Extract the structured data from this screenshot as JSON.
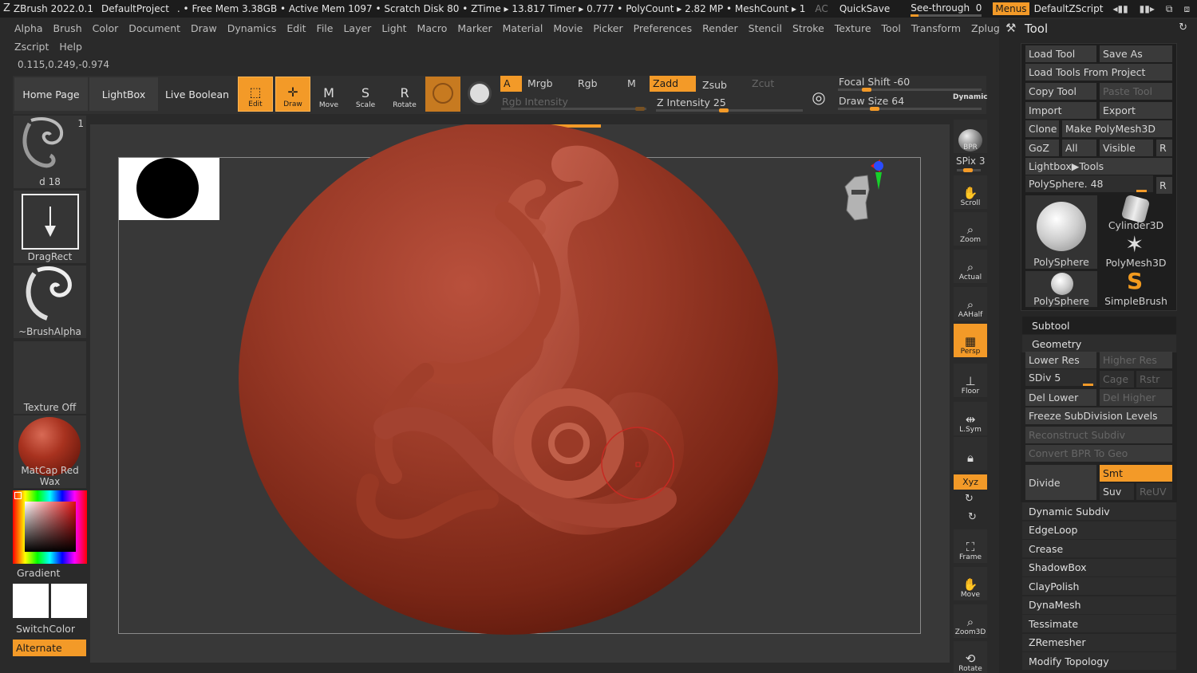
{
  "titlebar": {
    "app": "ZBrush 2022.0.1",
    "project": "DefaultProject",
    "stats": ". • Free Mem 3.38GB • Active Mem 1097 • Scratch Disk 80 • ZTime ▸ 13.817 Timer ▸ 0.777 • PolyCount ▸ 2.82 MP • MeshCount ▸ 1",
    "ac": "AC",
    "quicksave": "QuickSave",
    "seethrough": "See-through",
    "seethrough_value": "0",
    "menus": "Menus",
    "default_zscript": "DefaultZScript"
  },
  "menus": {
    "row1": [
      "Alpha",
      "Brush",
      "Color",
      "Document",
      "Draw",
      "Dynamics",
      "Edit",
      "File",
      "Layer",
      "Light",
      "Macro",
      "Marker",
      "Material",
      "Movie",
      "Picker",
      "Preferences",
      "Render",
      "Stencil",
      "Stroke",
      "Texture",
      "Tool",
      "Transform",
      "Zplugin"
    ],
    "row2": [
      "Zscript",
      "Help"
    ]
  },
  "coords": "0.115,0.249,-0.974",
  "shelf": {
    "home_page": "Home Page",
    "lightbox": "LightBox",
    "live_boolean": "Live Boolean",
    "edit": "Edit",
    "draw": "Draw",
    "move": "Move",
    "scale": "Scale",
    "rotate": "Rotate",
    "a": "A",
    "mrgb": "Mrgb",
    "rgb": "Rgb",
    "m": "M",
    "rgb_intensity": "Rgb Intensity",
    "zadd": "Zadd",
    "zsub": "Zsub",
    "zcut": "Zcut",
    "z_intensity": "Z Intensity 25",
    "z_intensity_value": 25,
    "focal_shift": "Focal Shift -60",
    "draw_size": "Draw Size 64",
    "dynamic": "Dynamic"
  },
  "left": {
    "brush_count": "1",
    "stroke_label": "d 18",
    "dragrect": "DragRect",
    "brushalpha": "~BrushAlpha",
    "texture_off": "Texture Off",
    "matcap": "MatCap Red Wax",
    "gradient": "Gradient",
    "switchcolor": "SwitchColor",
    "alternate": "Alternate"
  },
  "right_shelf": {
    "bpr": "BPR",
    "spix": "SPix 3",
    "scroll": "Scroll",
    "zoom": "Zoom",
    "actual": "Actual",
    "aahalf": "AAHalf",
    "persp": "Persp",
    "floor": "Floor",
    "lsym": "L.Sym",
    "xyz": "Xyz",
    "frame": "Frame",
    "move": "Move",
    "zoom3d": "Zoom3D",
    "rotate": "Rotate"
  },
  "tool": {
    "title": "Tool",
    "load_tool": "Load Tool",
    "save_as": "Save As",
    "load_tools_from_project": "Load Tools From Project",
    "copy_tool": "Copy Tool",
    "paste_tool": "Paste Tool",
    "import": "Import",
    "export": "Export",
    "clone": "Clone",
    "make_polymesh3d": "Make PolyMesh3D",
    "goz": "GoZ",
    "all": "All",
    "visible": "Visible",
    "r": "R",
    "lightbox_tools": "Lightbox▶Tools",
    "current_tool": "PolySphere. 48",
    "thumbs": [
      "PolySphere",
      "Cylinder3D",
      "PolyMesh3D",
      "PolySphere",
      "SimpleBrush"
    ],
    "subtool": "Subtool",
    "geometry": "Geometry",
    "lower_res": "Lower Res",
    "higher_res": "Higher Res",
    "sdiv": "SDiv 5",
    "cage": "Cage",
    "rstr": "Rstr",
    "del_lower": "Del Lower",
    "del_higher": "Del Higher",
    "freeze": "Freeze SubDivision Levels",
    "reconstruct": "Reconstruct Subdiv",
    "convert_bpr": "Convert BPR To Geo",
    "divide": "Divide",
    "smt": "Smt",
    "suv": "Suv",
    "reuv": "ReUV",
    "sections": [
      "Dynamic Subdiv",
      "EdgeLoop",
      "Crease",
      "ShadowBox",
      "ClayPolish",
      "DynaMesh",
      "Tessimate",
      "ZRemesher",
      "Modify Topology"
    ]
  }
}
